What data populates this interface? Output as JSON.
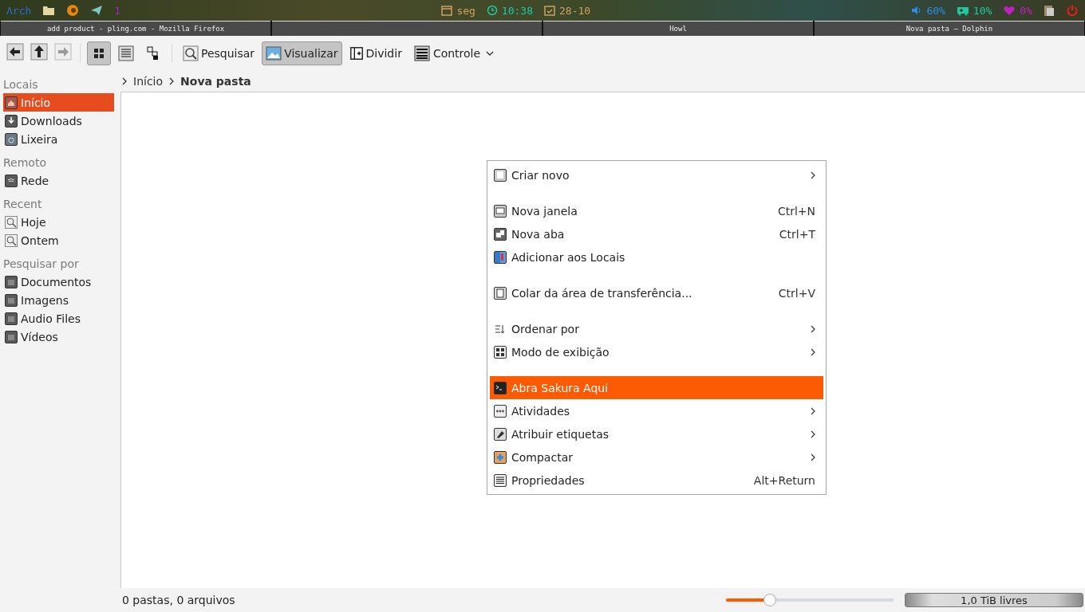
{
  "top_bar": {
    "logo": "Λrch",
    "workspace": "1",
    "day": "seg",
    "time": "10:38",
    "date": "28-10",
    "volume": "60%",
    "cpu": "10%",
    "memory": "0%"
  },
  "tasks": [
    {
      "kind": "window",
      "title": "add product - pling.com - Mozilla Firefox"
    },
    {
      "kind": "empty"
    },
    {
      "kind": "window",
      "title": "Howl"
    },
    {
      "kind": "window",
      "title": "Nova pasta — Dolphin"
    }
  ],
  "toolbar": {
    "view_modes": [
      {
        "kind": "icons",
        "selected": true
      },
      {
        "kind": "details",
        "selected": false
      },
      {
        "kind": "compact",
        "selected": false
      }
    ],
    "buttons": [
      {
        "kind": "search",
        "label": "Pesquisar",
        "selected": false
      },
      {
        "kind": "preview",
        "label": "Visualizar",
        "selected": true
      },
      {
        "kind": "split",
        "label": "Dividir",
        "selected": false
      },
      {
        "kind": "control",
        "label": "Controle",
        "selected": false
      }
    ]
  },
  "sidebar": {
    "sections": [
      {
        "title": "Locais",
        "items": [
          {
            "label": "Início",
            "kind": "home",
            "selected": true
          },
          {
            "label": "Downloads",
            "kind": "download",
            "selected": false
          },
          {
            "label": "Lixeira",
            "kind": "trash",
            "selected": false
          }
        ]
      },
      {
        "title": "Remoto",
        "items": [
          {
            "label": "Rede",
            "kind": "network",
            "selected": false
          }
        ]
      },
      {
        "title": "Recent",
        "items": [
          {
            "label": "Hoje",
            "kind": "search",
            "selected": false
          },
          {
            "label": "Ontem",
            "kind": "search",
            "selected": false
          }
        ]
      },
      {
        "title": "Pesquisar por",
        "items": [
          {
            "label": "Documentos",
            "kind": "folder",
            "selected": false
          },
          {
            "label": "Imagens",
            "kind": "folder",
            "selected": false
          },
          {
            "label": "Audio Files",
            "kind": "folder",
            "selected": false
          },
          {
            "label": "Vídeos",
            "kind": "folder",
            "selected": false
          }
        ]
      }
    ]
  },
  "breadcrumb": [
    {
      "label": "Início",
      "current": false
    },
    {
      "label": "Nova pasta",
      "current": true
    }
  ],
  "context_menu": [
    {
      "kind": "new",
      "label": "Criar novo",
      "submenu": true,
      "selected": false
    },
    {
      "kind": "separator"
    },
    {
      "kind": "window",
      "label": "Nova janela",
      "shortcut": "Ctrl+N",
      "submenu": false,
      "selected": false
    },
    {
      "kind": "tab",
      "label": "Nova aba",
      "shortcut": "Ctrl+T",
      "submenu": false,
      "selected": false
    },
    {
      "kind": "places",
      "label": "Adicionar aos Locais",
      "submenu": false,
      "selected": false
    },
    {
      "kind": "separator"
    },
    {
      "kind": "paste",
      "label": "Colar da área de transferência...",
      "shortcut": "Ctrl+V",
      "submenu": false,
      "selected": false
    },
    {
      "kind": "separator"
    },
    {
      "kind": "sort",
      "label": "Ordenar por",
      "submenu": true,
      "selected": false
    },
    {
      "kind": "view",
      "label": "Modo de exibição",
      "submenu": true,
      "selected": false
    },
    {
      "kind": "separator"
    },
    {
      "kind": "terminal",
      "label": "Abra Sakura Aqui",
      "submenu": false,
      "selected": true
    },
    {
      "kind": "activities",
      "label": "Atividades",
      "submenu": true,
      "selected": false
    },
    {
      "kind": "tag",
      "label": "Atribuir etiquetas",
      "submenu": true,
      "selected": false
    },
    {
      "kind": "archive",
      "label": "Compactar",
      "submenu": true,
      "selected": false
    },
    {
      "kind": "properties",
      "label": "Propriedades",
      "shortcut": "Alt+Return",
      "submenu": false,
      "selected": false
    }
  ],
  "status_bar": {
    "text": "0 pastas, 0 arquivos",
    "zoom": {
      "level": 0.26
    },
    "free_space": "1,0 TiB livres"
  }
}
